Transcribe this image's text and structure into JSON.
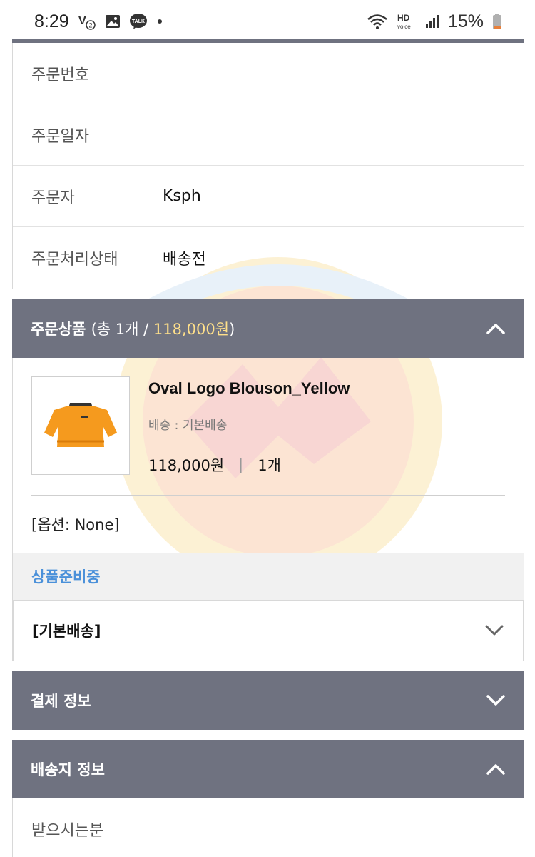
{
  "status_bar": {
    "time": "8:29",
    "icons": [
      "volte-2-icon",
      "gallery-icon",
      "kakaotalk-icon",
      "dot-icon"
    ],
    "right_icons": [
      "wifi-icon",
      "hd-voice-icon",
      "signal-icon"
    ],
    "hd_label": "HD",
    "voice_label": "voice",
    "talk_label": "TALK",
    "battery": "15%",
    "battery_level": 0.15
  },
  "order_info": {
    "rows": [
      {
        "label": "주문번호",
        "value": ""
      },
      {
        "label": "주문일자",
        "value": ""
      },
      {
        "label": "주문자",
        "value": "Ksph"
      },
      {
        "label": "주문처리상태",
        "value": "배송전"
      }
    ]
  },
  "products_section": {
    "title": "주문상품",
    "count": "(총 1개 / ",
    "price": "118,000원",
    "close": ")",
    "toggle_icon": "chevron-up-icon"
  },
  "product": {
    "name": "Oval Logo Blouson_Yellow",
    "shipping": "배송 : 기본배송",
    "price": "118,000원",
    "separator": "|",
    "quantity": "1개",
    "option": "[옵션: None]",
    "image_icon": "yellow-jacket-image"
  },
  "prep_status": "상품준비중",
  "shipping_accordion": {
    "label": "[기본배송]",
    "toggle_icon": "chevron-down-icon"
  },
  "payment_section": {
    "title": "결제 정보",
    "toggle_icon": "chevron-down-icon"
  },
  "delivery_section": {
    "title": "배송지 정보",
    "toggle_icon": "chevron-up-icon"
  },
  "recipient": {
    "label": "받으시는분",
    "value": ""
  },
  "colors": {
    "header_bg": "#6f7280",
    "accent_blue": "#4a90d9",
    "price_highlight": "#ffe08a"
  }
}
